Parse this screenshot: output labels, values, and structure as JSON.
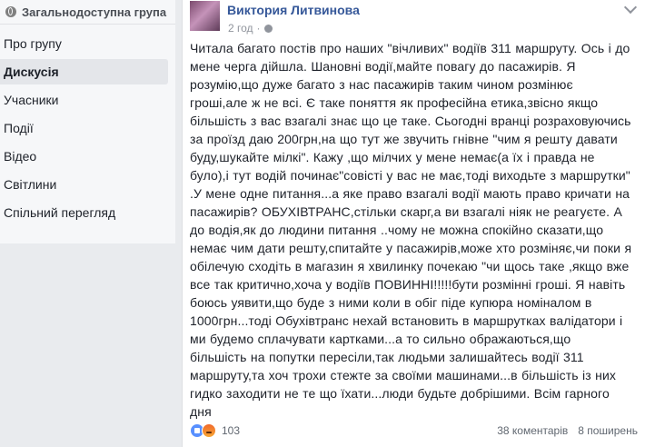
{
  "sidebar": {
    "header": "Загальнодоступна група",
    "items": [
      {
        "label": "Про групу",
        "active": false
      },
      {
        "label": "Дискусія",
        "active": true
      },
      {
        "label": "Учасники",
        "active": false
      },
      {
        "label": "Події",
        "active": false
      },
      {
        "label": "Відео",
        "active": false
      },
      {
        "label": "Світлини",
        "active": false
      },
      {
        "label": "Спільний перегляд",
        "active": false
      }
    ]
  },
  "post": {
    "author": "Виктория Литвинова",
    "time": "2 год",
    "lines": [
      "Читала багато постів про наших \"вічливих\" водіїв 311 маршруту. Ось і до",
      "мене черга дійшла. Шановні водії,майте повагу до пасажирів. Я",
      "розумію,що дуже багато з нас пасажирів таким чином розмінює",
      "гроші,але ж не всі. Є таке поняття як професійна етика,звісно якщо",
      "більшість з вас взагалі знає що це таке. Сьогодні вранці розраховуючись",
      "за проїзд даю 200грн,на що тут же звучить гнівне \"чим я решту давати",
      "буду,шукайте мілкі\". Кажу ,що мілчих у мене немає(а їх і правда не",
      "було),і тут водій починає\"совісті у вас не має,тоді виходьте з маршрутки\"",
      ".У мене одне питання...а яке право взагалі водії мають право кричати на",
      "пасажирів? ОБУХІВТРАНС,стільки скарг,а ви взагалі ніяк не реагуєте. А",
      "до водія,як до людини питання ..чому не можна спокійно сказати,що",
      "немає чим дати решту,спитайте у пасажирів,може хто розміняє,чи поки я",
      "обілечую сходіть в магазин я хвилинку почекаю \"чи щось таке ,якщо вже",
      "все так критично,хоча у водіїв ПОВИННІ!!!!!бути розмінні гроші. Я навіть",
      "боюсь уявити,що буде з ними коли в обіг піде купюра номіналом в",
      "1000грн...тоді Обухівтранс нехай встановить в маршрутках валідатори і",
      "ми будемо сплачувати картками...а то сильно ображаються,що",
      "більшість на попутки пересіли,так людьми залишайтесь водії 311",
      "маршруту,та хоч трохи стежте за своїми машинами...в більшість із них",
      "гидко заходити не те що їхати...люди будьте добрішими. Всім гарного",
      "дня"
    ],
    "reactions_count": "103",
    "comments": "38 коментарів",
    "shares": "8 поширень"
  }
}
